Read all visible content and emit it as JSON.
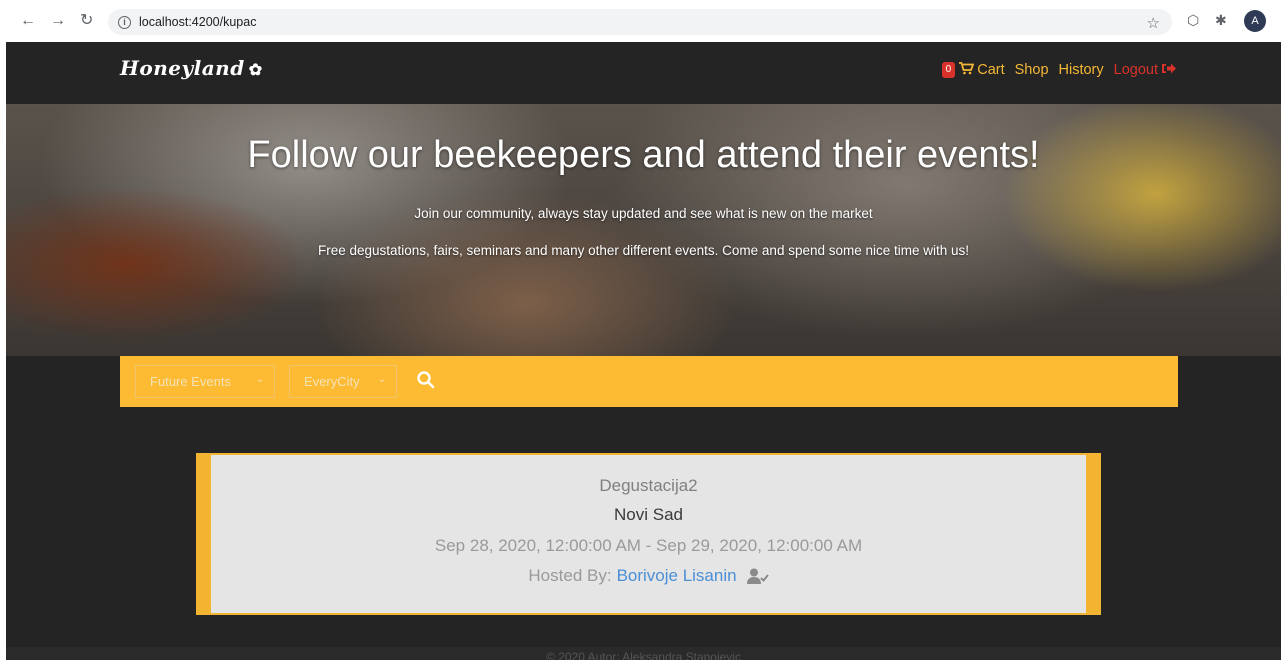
{
  "browser": {
    "url": "localhost:4200/kupac",
    "profile_initial": "A"
  },
  "navbar": {
    "brand": "Honeyland",
    "cart_count": "0",
    "cart_label": "Cart",
    "shop_label": "Shop",
    "history_label": "History",
    "logout_label": "Logout"
  },
  "hero": {
    "title": "Follow our beekeepers and attend their events!",
    "line1": "Join our community, always stay updated and see what is new on the market",
    "line2": "Free degustations, fairs, seminars and many other different events. Come and spend some nice time with us!"
  },
  "filters": {
    "time_filter": "Future Events",
    "city_filter": "EveryCity"
  },
  "event": {
    "name": "Degustacija2",
    "city": "Novi Sad",
    "dates": "Sep 28, 2020, 12:00:00 AM - Sep 29, 2020, 12:00:00 AM",
    "hosted_by_label": "Hosted By:",
    "host_name": "Borivoje Lisanin"
  },
  "footer": {
    "text": "© 2020 Autor: Aleksandra Stanojevic"
  },
  "colors": {
    "accent": "#fdba33",
    "background": "#242424",
    "danger": "#d9322b",
    "link": "#4b8fd6"
  }
}
